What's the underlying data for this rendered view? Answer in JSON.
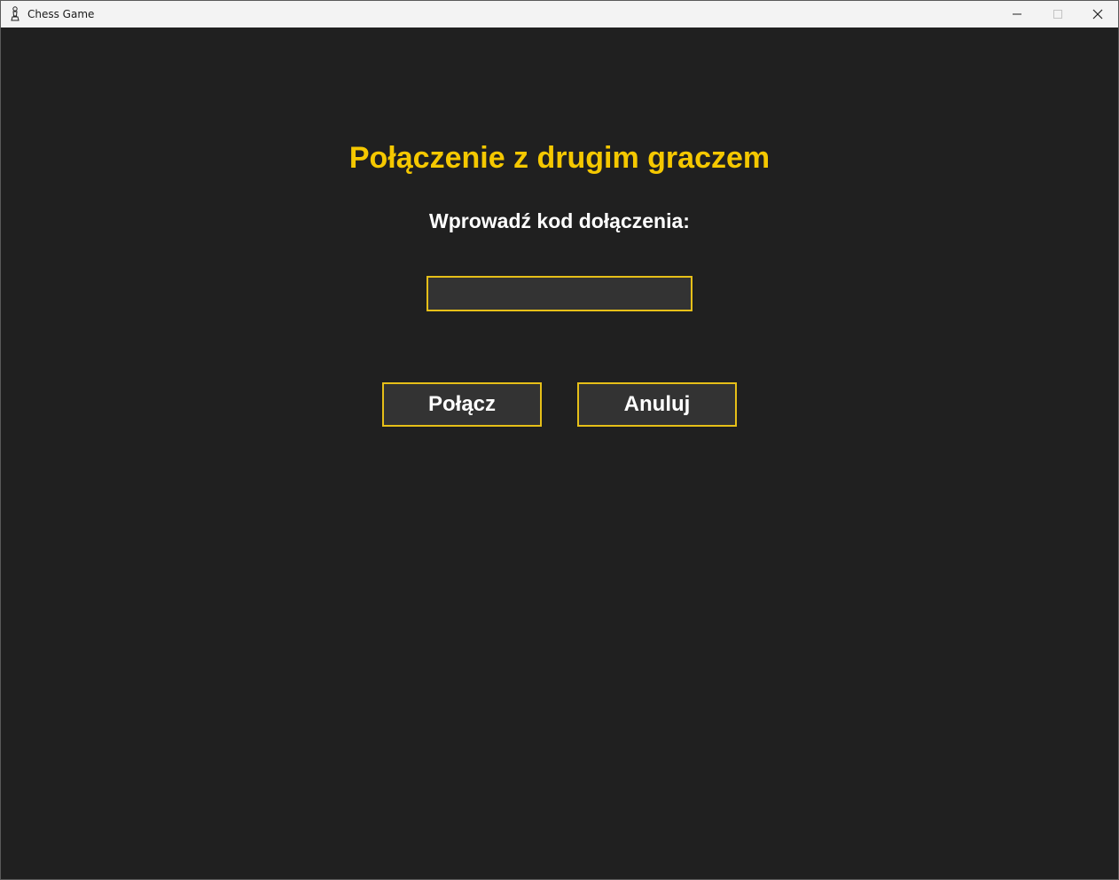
{
  "window": {
    "title": "Chess Game",
    "icon": "chess-pawn-icon",
    "controls": [
      "minimize-icon",
      "maximize-icon",
      "close-icon"
    ]
  },
  "dialog": {
    "heading": "Połączenie z drugim graczem",
    "prompt": "Wprowadź kod dołączenia:",
    "code_input": {
      "value": "",
      "placeholder": ""
    },
    "connect_label": "Połącz",
    "cancel_label": "Anuluj"
  },
  "colors": {
    "background": "#202020",
    "accent": "#f5c800",
    "border": "#e6bf18",
    "button_bg": "#333333",
    "text": "#ffffff"
  }
}
